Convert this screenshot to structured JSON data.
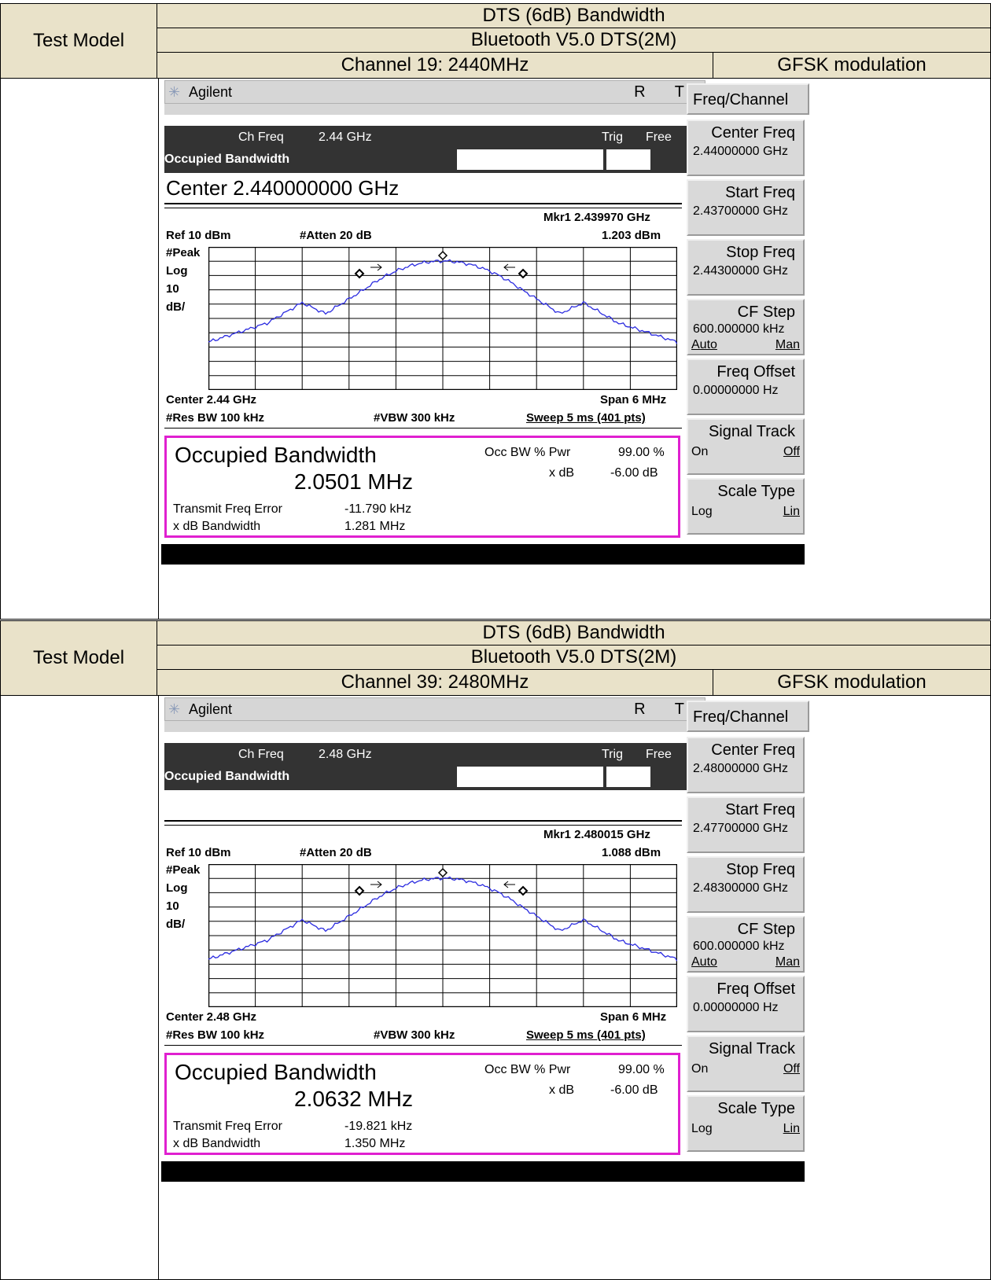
{
  "blocks": [
    {
      "header": {
        "test_model_label": "Test Model",
        "row1": "DTS (6dB) Bandwidth",
        "row2": "Bluetooth V5.0 DTS(2M)",
        "row3_channel": "Channel 19: 2440MHz",
        "row3_mod": "GFSK modulation"
      },
      "screen": {
        "brand": "Agilent",
        "rt": "R T",
        "ch_freq_label": "Ch Freq",
        "ch_freq_value": "2.44 GHz",
        "trig_label": "Trig",
        "trig_value": "Free",
        "measurement": "Occupied Bandwidth",
        "center_big": "Center 2.440000000 GHz",
        "mkr": "Mkr1  2.439970 GHz",
        "ref": "Ref 10 dBm",
        "atten": "#Atten 20 dB",
        "mkr_amp": "1.203 dBm",
        "peak": "#Peak",
        "log": "Log",
        "ten": "10",
        "dbdiv": "dB/",
        "center": "Center 2.44 GHz",
        "span": "Span 6 MHz",
        "rbw": "#Res BW 100 kHz",
        "vbw": "#VBW 300 kHz",
        "sweep": "Sweep 5 ms (401 pts)",
        "obw_title": "Occupied Bandwidth",
        "obw_value": "2.0501 MHz",
        "occ_label": "Occ BW % Pwr",
        "occ_value": "99.00 %",
        "xdb_label": "x dB",
        "xdb_value": "-6.00 dB",
        "tfe_label": "Transmit Freq Error",
        "tfe_value": "-11.790 kHz",
        "xdbbw_label": "x dB Bandwidth",
        "xdbbw_value": "1.281 MHz",
        "softkeys": {
          "freq_channel": "Freq/Channel",
          "center_freq": "Center Freq",
          "center_freq_val": "2.44000000 GHz",
          "start_freq": "Start Freq",
          "start_freq_val": "2.43700000 GHz",
          "stop_freq": "Stop Freq",
          "stop_freq_val": "2.44300000 GHz",
          "cf_step": "CF Step",
          "cf_step_val": "600.000000 kHz",
          "auto": "Auto",
          "man": "Man",
          "freq_offset": "Freq Offset",
          "freq_offset_val": "0.00000000  Hz",
          "signal_track": "Signal Track",
          "on": "On",
          "off": "Off",
          "scale_type": "Scale Type",
          "log": "Log",
          "lin": "Lin"
        }
      }
    },
    {
      "header": {
        "test_model_label": "Test Model",
        "row1": "DTS (6dB) Bandwidth",
        "row2": "Bluetooth V5.0 DTS(2M)",
        "row3_channel": "Channel 39: 2480MHz",
        "row3_mod": "GFSK modulation"
      },
      "screen": {
        "brand": "Agilent",
        "rt": "R T",
        "ch_freq_label": "Ch Freq",
        "ch_freq_value": "2.48 GHz",
        "trig_label": "Trig",
        "trig_value": "Free",
        "measurement": "Occupied Bandwidth",
        "center_big": "",
        "mkr": "Mkr1  2.480015 GHz",
        "ref": "Ref 10 dBm",
        "atten": "#Atten 20 dB",
        "mkr_amp": "1.088 dBm",
        "peak": "#Peak",
        "log": "Log",
        "ten": "10",
        "dbdiv": "dB/",
        "center": "Center 2.48 GHz",
        "span": "Span 6 MHz",
        "rbw": "#Res BW 100 kHz",
        "vbw": "#VBW 300 kHz",
        "sweep": "Sweep 5 ms (401 pts)",
        "obw_title": "Occupied Bandwidth",
        "obw_value": "2.0632 MHz",
        "occ_label": "Occ BW % Pwr",
        "occ_value": "99.00 %",
        "xdb_label": "x dB",
        "xdb_value": "-6.00 dB",
        "tfe_label": "Transmit Freq Error",
        "tfe_value": "-19.821 kHz",
        "xdbbw_label": "x dB Bandwidth",
        "xdbbw_value": "1.350 MHz",
        "softkeys": {
          "freq_channel": "Freq/Channel",
          "center_freq": "Center Freq",
          "center_freq_val": "2.48000000 GHz",
          "start_freq": "Start Freq",
          "start_freq_val": "2.47700000 GHz",
          "stop_freq": "Stop Freq",
          "stop_freq_val": "2.48300000 GHz",
          "cf_step": "CF Step",
          "cf_step_val": "600.000000 kHz",
          "auto": "Auto",
          "man": "Man",
          "freq_offset": "Freq Offset",
          "freq_offset_val": "0.00000000  Hz",
          "signal_track": "Signal Track",
          "on": "On",
          "off": "Off",
          "scale_type": "Scale Type",
          "log": "Log",
          "lin": "Lin"
        }
      }
    }
  ]
}
